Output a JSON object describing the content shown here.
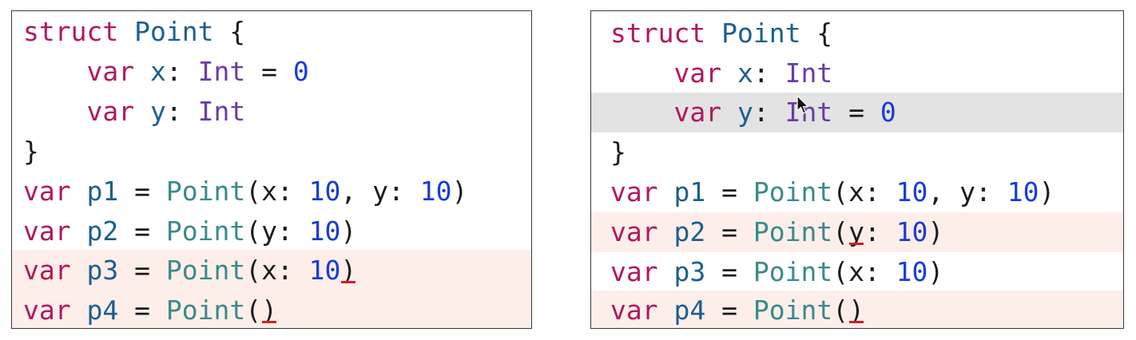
{
  "colors": {
    "keyword": "#b0185f",
    "identifier": "#1c5f8f",
    "type": "#6b3ca6",
    "function": "#3a8a8a",
    "number": "#1a3bd6",
    "plain": "#1b1b1b",
    "error_line_bg": "#fdeeea",
    "current_line_bg": "#e3e3e3",
    "error_underline": "#d0202a"
  },
  "tok": {
    "struct": "struct",
    "var": "var",
    "point_type": "Point",
    "point_call": "Point",
    "open_brace": " {",
    "close_brace": "}",
    "indent": "    ",
    "x": "x",
    "y": "y",
    "p1": "p1",
    "p2": "p2",
    "p3": "p3",
    "p4": "p4",
    "colon_sp": ": ",
    "int": "Int",
    "assign": " = ",
    "zero": "0",
    "ten": "10",
    "open_paren": "(",
    "close_paren": ")",
    "arg_x": "x: ",
    "arg_y": "y: ",
    "y_label_rest": ": ",
    "comma_y": ", y: "
  },
  "icons": {
    "cursor": "mouse-pointer-icon"
  }
}
